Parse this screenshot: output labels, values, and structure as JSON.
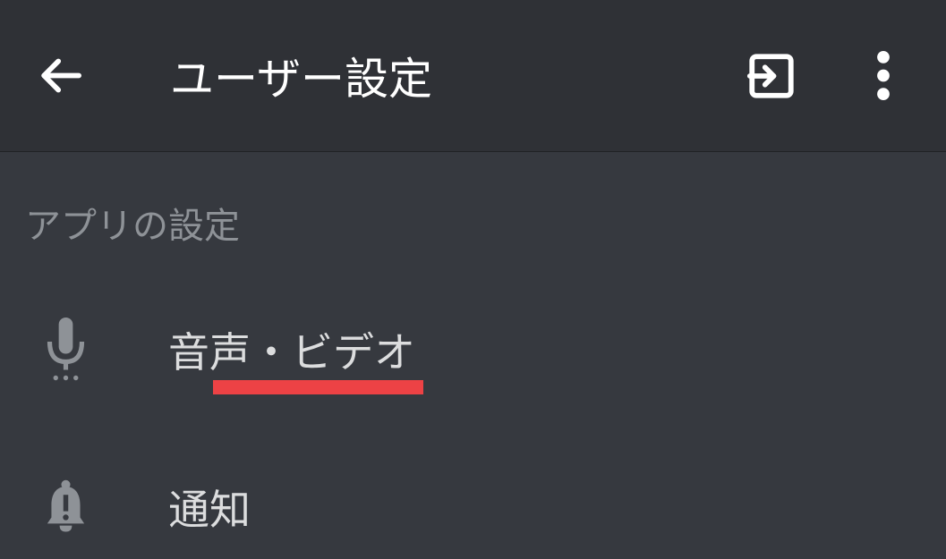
{
  "header": {
    "title": "ユーザー設定"
  },
  "section": {
    "label": "アプリの設定"
  },
  "items": [
    {
      "label": "音声・ビデオ"
    },
    {
      "label": "通知"
    }
  ]
}
